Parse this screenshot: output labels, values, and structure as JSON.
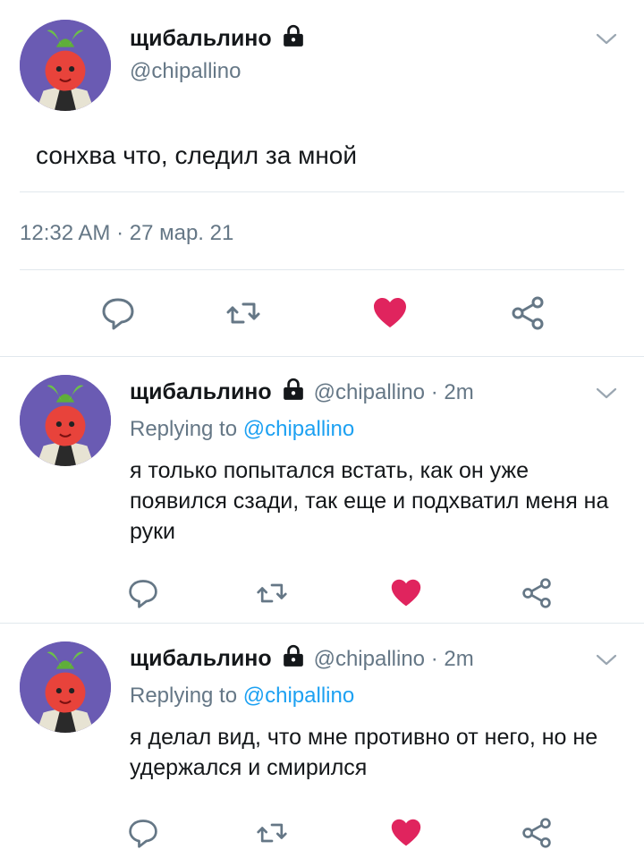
{
  "main_tweet": {
    "display_name": "щибальлино",
    "handle": "@chipallino",
    "text": "сонхва что, следил за мной",
    "timestamp": "12:32 AM · 27 мар. 21",
    "liked": true
  },
  "replies": [
    {
      "display_name": "щибальлино",
      "handle_time": "@chipallino · 2m",
      "replying_prefix": "Replying to",
      "replying_to": "@chipallino",
      "text": "я только попытался встать, как он уже появился сзади, так еще и подхватил меня на руки"
    },
    {
      "display_name": "щибальлино",
      "handle_time": "@chipallino · 2m",
      "replying_prefix": "Replying to",
      "replying_to": "@chipallino",
      "text": "я делал вид, что мне противно от него, но не удержался и смирился"
    }
  ],
  "colors": {
    "like": "#e0245e",
    "link": "#1da1f2",
    "muted": "#657786",
    "avatar_bg": "#6a5bb3"
  },
  "icons": [
    "lock-icon",
    "chevron-down-icon",
    "reply-icon",
    "retweet-icon",
    "heart-icon",
    "share-icon"
  ]
}
